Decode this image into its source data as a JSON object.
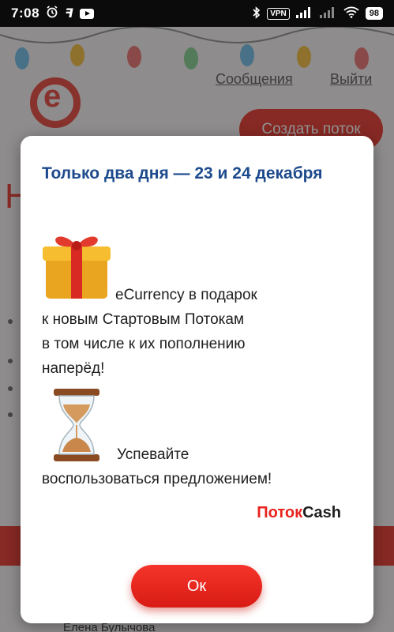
{
  "status_bar": {
    "time": "7:08",
    "vpn": "VPN",
    "battery": "98"
  },
  "background": {
    "messages_link": "Сообщения",
    "logout_link": "Выйти",
    "create_button": "Создать поток",
    "user_name": "Елена Булычова"
  },
  "dialog": {
    "title": "Только два дня — 23 и 24 декабря",
    "gift_line1": "eCurrency в подарок",
    "gift_line2": "к новым Стартовым Потокам",
    "gift_line3": "в том числе к их пополнению",
    "gift_line4": "наперёд!",
    "hurry_line1": "Успевайте",
    "hurry_line2": "воспользоваться предложением!",
    "brand_red": "Поток",
    "brand_dark": "Cash",
    "ok_label": "Ок"
  },
  "colors": {
    "title_blue": "#1c4a8c",
    "brand_red": "#e8231e",
    "button_red": "#e8271f"
  },
  "icons": [
    "gift-icon",
    "hourglass-icon",
    "alarm-icon",
    "bluetooth-icon",
    "signal-icon",
    "wifi-icon",
    "battery-icon",
    "youtube-icon"
  ]
}
